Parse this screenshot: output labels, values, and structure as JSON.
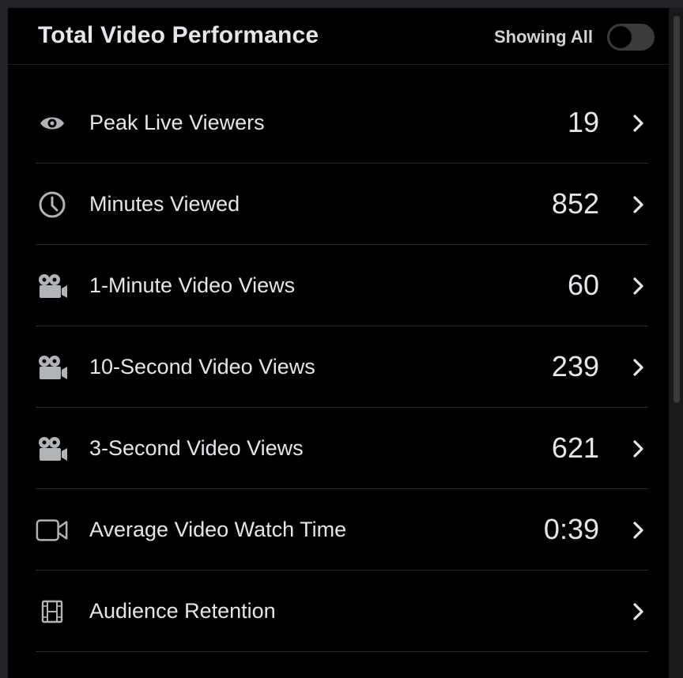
{
  "header": {
    "title": "Total Video Performance",
    "showing_label": "Showing All",
    "toggle_on": false
  },
  "metrics": [
    {
      "icon": "eye-icon",
      "label": "Peak Live Viewers",
      "value": "19"
    },
    {
      "icon": "clock-icon",
      "label": "Minutes Viewed",
      "value": "852"
    },
    {
      "icon": "movie-camera-icon",
      "label": "1-Minute Video Views",
      "value": "60"
    },
    {
      "icon": "movie-camera-icon",
      "label": "10-Second Video Views",
      "value": "239"
    },
    {
      "icon": "movie-camera-icon",
      "label": "3-Second Video Views",
      "value": "621"
    },
    {
      "icon": "video-camera-icon",
      "label": "Average Video Watch Time",
      "value": "0:39"
    },
    {
      "icon": "film-strip-icon",
      "label": "Audience Retention",
      "value": ""
    }
  ],
  "colors": {
    "background": "#000000",
    "text": "#e4e6eb",
    "icon": "#b0b3b8",
    "divider": "#2a2a2c",
    "toggle_track": "#3a3b3c"
  }
}
